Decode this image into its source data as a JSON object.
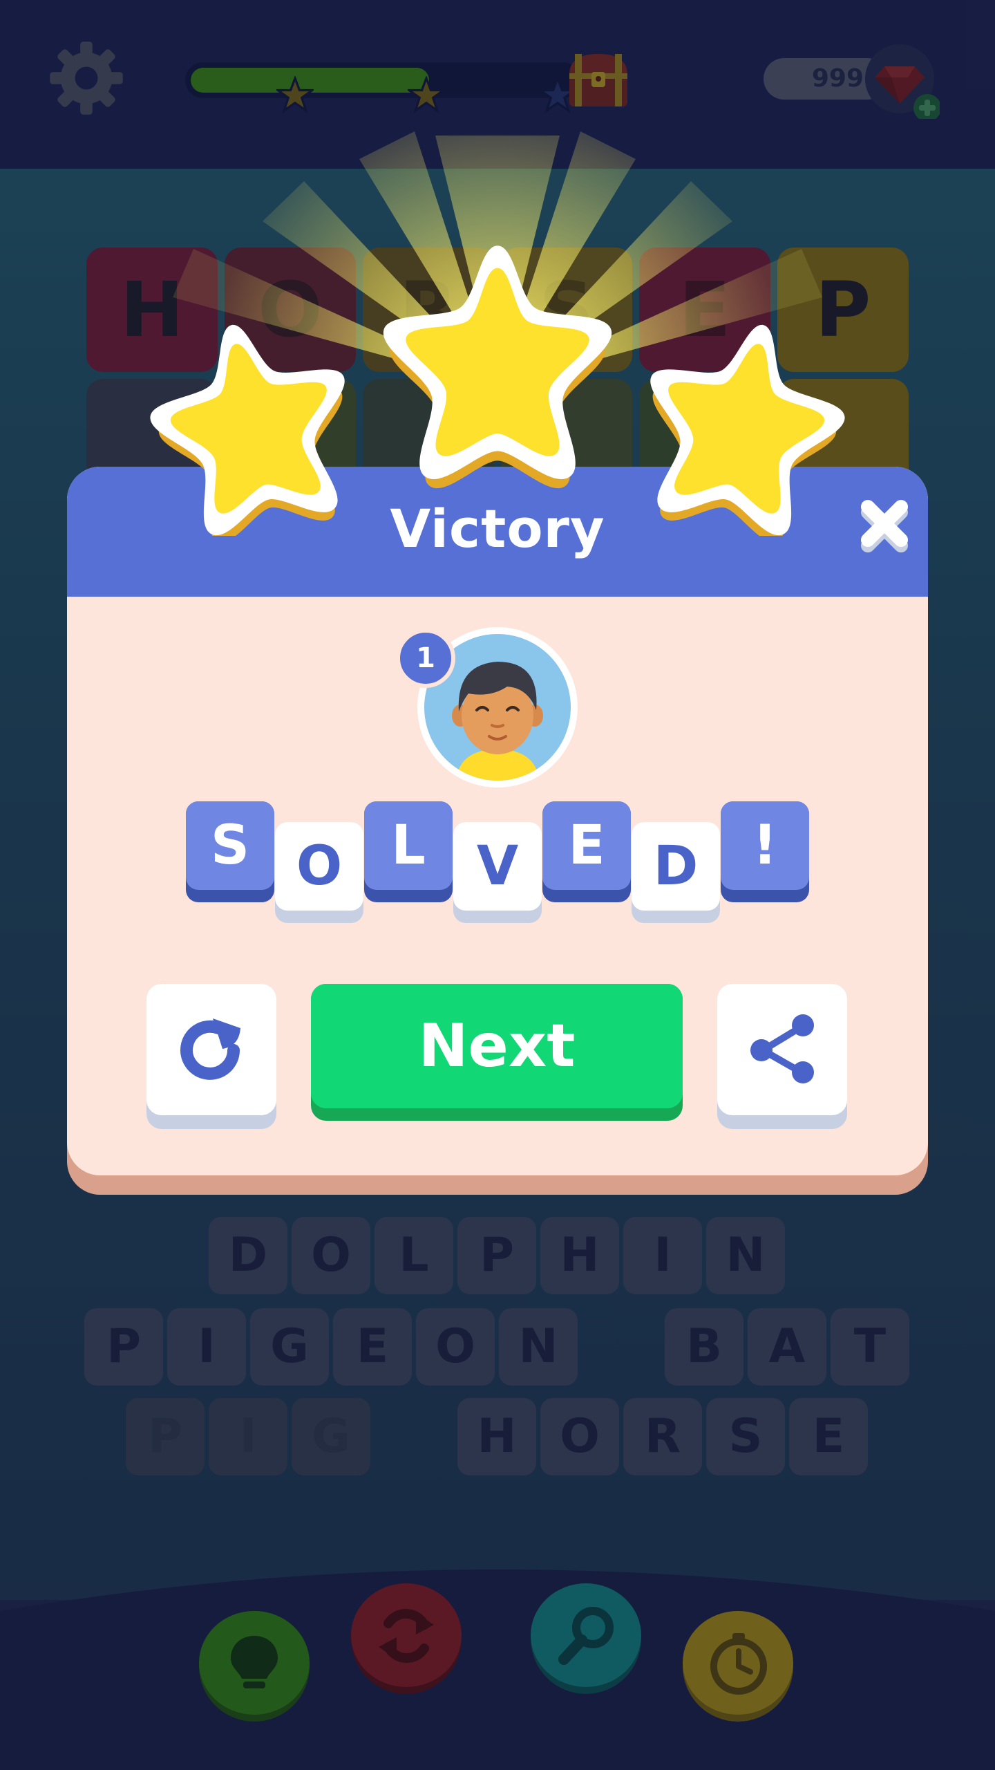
{
  "header": {
    "settings_icon": "gear-icon",
    "level_progress": 0.62,
    "progress_stars": [
      "star-icon",
      "star-icon",
      "star-icon"
    ],
    "reward_icon": "treasure-chest-icon",
    "gems": {
      "count": "999",
      "icon": "ruby-gem-icon",
      "add_icon": "plus-icon"
    }
  },
  "board": {
    "letter_grid_top": [
      "H",
      "O",
      "R",
      "S",
      "E",
      "P"
    ],
    "words": [
      {
        "letters": [
          "D",
          "O",
          "L",
          "P",
          "H",
          "I",
          "N"
        ],
        "found": true
      },
      {
        "letters": [
          "P",
          "I",
          "G",
          "E",
          "O",
          "N"
        ],
        "found": true
      },
      {
        "letters": [
          "B",
          "A",
          "T"
        ],
        "found": true
      },
      {
        "letters": [
          "P",
          "I",
          "G"
        ],
        "found": false
      },
      {
        "letters": [
          "H",
          "O",
          "R",
          "S",
          "E"
        ],
        "found": true
      }
    ]
  },
  "tools": [
    {
      "name": "hint-button",
      "icon": "lightbulb-icon",
      "color": "#2f8a12"
    },
    {
      "name": "shuffle-button",
      "icon": "shuffle-icon",
      "color": "#8f1b23"
    },
    {
      "name": "search-button",
      "icon": "magnifier-icon",
      "color": "#0f8a8a"
    },
    {
      "name": "time-button",
      "icon": "stopwatch-icon",
      "color": "#b29410"
    }
  ],
  "modal": {
    "title": "Victory",
    "close_icon": "close-icon",
    "stars_earned": 3,
    "player": {
      "rank": "1",
      "avatar_icon": "player-avatar"
    },
    "solved_letters": [
      "S",
      "O",
      "L",
      "V",
      "E",
      "D",
      "!"
    ],
    "buttons": {
      "replay_icon": "replay-icon",
      "next_label": "Next",
      "share_icon": "share-icon"
    }
  },
  "colors": {
    "header_blue": "#5670d5",
    "panel_bg": "#fde5db",
    "next_green": "#12d775",
    "star_yellow": "#fde12d"
  }
}
